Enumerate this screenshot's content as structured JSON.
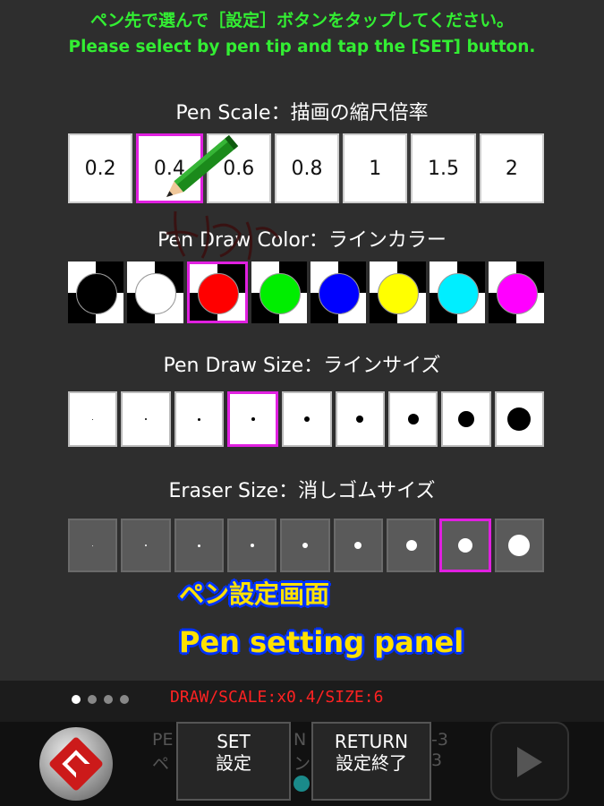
{
  "instructions": {
    "jp": "ペン先で選んで［設定］ボタンをタップしてください。",
    "en": "Please select by pen tip and tap the [SET] button."
  },
  "pen_scale": {
    "title": "Pen Scale：描画の縮尺倍率",
    "options": [
      "0.2",
      "0.4",
      "0.6",
      "0.8",
      "1",
      "1.5",
      "2"
    ],
    "selected": "0.4"
  },
  "pen_color": {
    "title": "Pen Draw Color：ラインカラー",
    "colors": [
      "#000000",
      "#ffffff",
      "#ff0000",
      "#00ee00",
      "#0000ff",
      "#ffff00",
      "#00eeff",
      "#ff00ff"
    ],
    "selected": "#ff0000"
  },
  "pen_size": {
    "title": "Pen Draw Size：ラインサイズ",
    "option_count": 9,
    "selected_index": 3
  },
  "eraser_size": {
    "title": "Eraser Size：消しゴムサイズ",
    "option_count": 9,
    "selected_index": 7
  },
  "captions": {
    "jp": "ペン設定画面",
    "en": "Pen setting panel"
  },
  "status": {
    "text": "DRAW/SCALE:x0.4/SIZE:6",
    "pages": 4,
    "current_page": 1
  },
  "buttons": {
    "set_en": "SET",
    "set_jp": "設定",
    "return_en": "RETURN",
    "return_jp": "設定終了"
  },
  "background_text": {
    "left_top": "PE",
    "left_bottom": "ペ",
    "right_top": "N",
    "right_bottom": "ン",
    "far_right_top": "-3",
    "far_right_bottom": "3"
  },
  "icons": {
    "app_logo": "app-logo-icon",
    "pen": "pen-icon",
    "next": "play-arrow-icon"
  }
}
